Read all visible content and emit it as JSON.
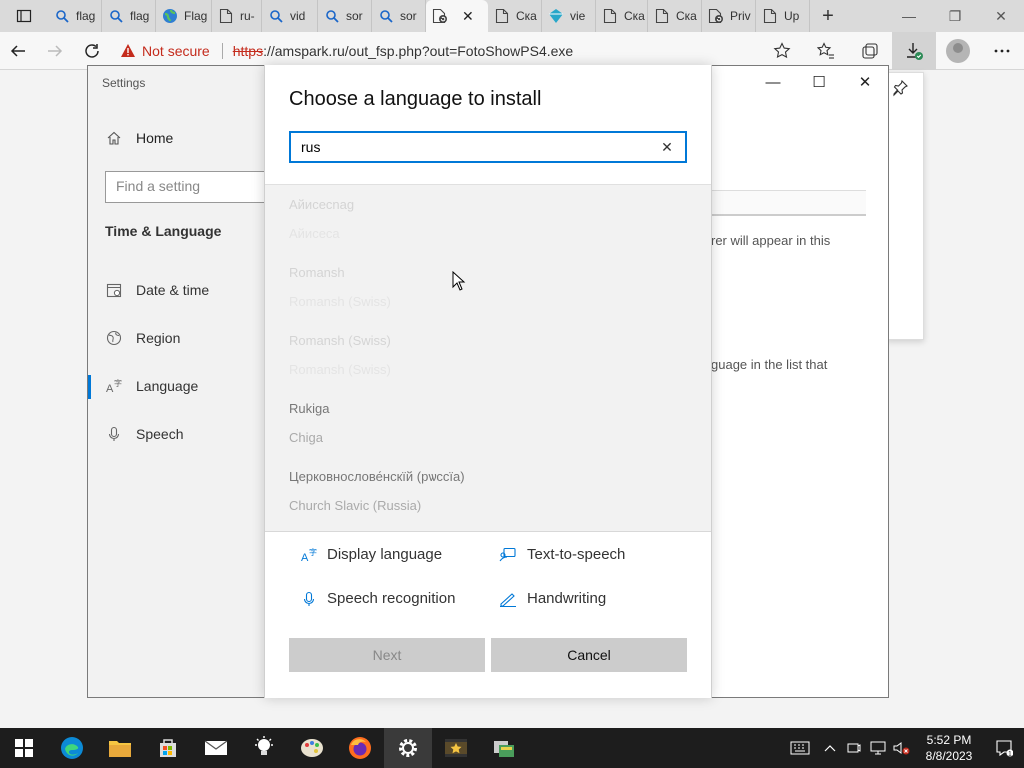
{
  "browser": {
    "tabs": [
      {
        "icon": "search-icon",
        "label": "flag"
      },
      {
        "icon": "search-icon",
        "label": "flag"
      },
      {
        "icon": "globe-icon",
        "label": "Flag"
      },
      {
        "icon": "page-icon",
        "label": "ru-"
      },
      {
        "icon": "search-icon",
        "label": "vid"
      },
      {
        "icon": "search-icon",
        "label": "sor"
      },
      {
        "icon": "search-icon",
        "label": "sor"
      },
      {
        "icon": "page-refresh-icon",
        "label": "",
        "active": true
      },
      {
        "icon": "page-icon",
        "label": "Ска"
      },
      {
        "icon": "diamond-icon",
        "label": "vie"
      },
      {
        "icon": "page-icon",
        "label": "Ска"
      },
      {
        "icon": "page-icon",
        "label": "Ска"
      },
      {
        "icon": "page-refresh-icon",
        "label": "Priv"
      },
      {
        "icon": "page-icon",
        "label": "Up"
      }
    ],
    "not_secure_label": "Not secure",
    "url_protocol": "https",
    "url_rest": "://amspark.ru/out_fsp.php?out=FotoShowPS4.exe"
  },
  "settings": {
    "window_title": "Settings",
    "home_label": "Home",
    "search_placeholder": "Find a setting",
    "section_title": "Time & Language",
    "nav": [
      {
        "icon": "calendar-icon",
        "label": "Date & time"
      },
      {
        "icon": "globe-icon",
        "label": "Region"
      },
      {
        "icon": "language-icon",
        "label": "Language",
        "selected": true
      },
      {
        "icon": "microphone-icon",
        "label": "Speech"
      }
    ],
    "bg_text_1": "rer will appear in this",
    "bg_text_2": "guage in the list that"
  },
  "dialog": {
    "title": "Choose a language to install",
    "search_value": "rus",
    "languages": [
      {
        "name": "Aйисесnaɡ",
        "sub": "Aйисесa",
        "faded": true
      },
      {
        "name": "Rоmаnsh",
        "sub": "Rоmаnsh (Swiss)",
        "faded": true
      },
      {
        "name": "Rоmаnsh (Swiss)",
        "sub": "Rоmаnsh (Swiss)",
        "faded": true
      },
      {
        "name": "Rukiga",
        "sub": "Chiga",
        "faded": false
      },
      {
        "name": "Церковнослове́нскїй (рѡссїа)",
        "sub": "Church Slavic (Russia)",
        "faded": false
      }
    ],
    "features": {
      "display_language": "Display language",
      "text_to_speech": "Text-to-speech",
      "speech_recognition": "Speech recognition",
      "handwriting": "Handwriting"
    },
    "next_label": "Next",
    "cancel_label": "Cancel"
  },
  "taskbar": {
    "time": "5:52 PM",
    "date": "8/8/2023"
  },
  "colors": {
    "accent": "#0078d7",
    "not_secure": "#c42b1c",
    "taskbar": "#1d1d1d"
  }
}
